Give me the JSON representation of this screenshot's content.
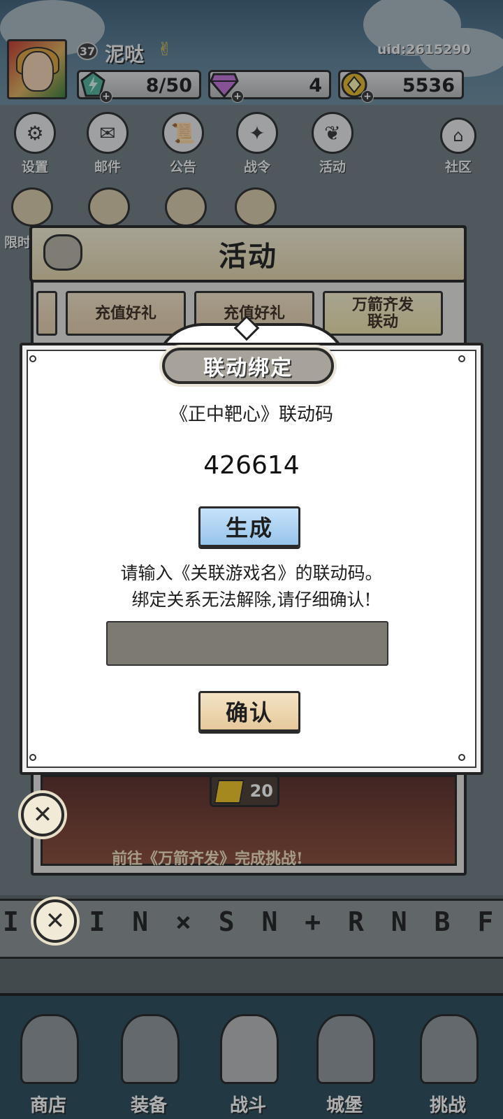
{
  "player": {
    "level": "37",
    "name": "泥哒",
    "uid": "uid:2615290"
  },
  "resources": {
    "stamina": "8/50",
    "gems": "4",
    "gold": "5536",
    "plus": "+"
  },
  "top_menu": [
    {
      "label": "设置",
      "icon": "gear-icon"
    },
    {
      "label": "邮件",
      "icon": "mail-icon"
    },
    {
      "label": "公告",
      "icon": "scroll-icon"
    },
    {
      "label": "战令",
      "icon": "battle-pass-icon"
    },
    {
      "label": "活动",
      "icon": "activity-icon"
    },
    {
      "label": "社区",
      "icon": "community-icon"
    }
  ],
  "side_label": "限时",
  "activity_panel": {
    "title": "活动",
    "tabs": [
      "充值好礼",
      "充值好礼",
      "万箭齐发\n联动"
    ],
    "reward_count": "20",
    "banner_text": "前往《万箭齐发》完成挑战!"
  },
  "dialog": {
    "title": "联动绑定",
    "code_label": "《正中靶心》联动码",
    "code_value": "426614",
    "generate_label": "生成",
    "hint_line1": "请输入《关联游戏名》的联动码。",
    "hint_line2": "绑定关系无法解除,请仔细确认!",
    "input_value": "",
    "confirm_label": "确认"
  },
  "close_glyph": "✕",
  "runes": "I  O I N ⨯ S N + R N B F",
  "bottom_nav": [
    {
      "label": "商店",
      "icon": "shop-icon"
    },
    {
      "label": "装备",
      "icon": "backpack-icon"
    },
    {
      "label": "战斗",
      "icon": "crossed-swords-icon"
    },
    {
      "label": "城堡",
      "icon": "castle-icon"
    },
    {
      "label": "挑战",
      "icon": "shield-icon"
    }
  ],
  "colors": {
    "generate_button": "#97c4ea",
    "confirm_button": "#e6c99c",
    "input_bg": "#7d7a72",
    "title_pill": "#a7a39a"
  }
}
